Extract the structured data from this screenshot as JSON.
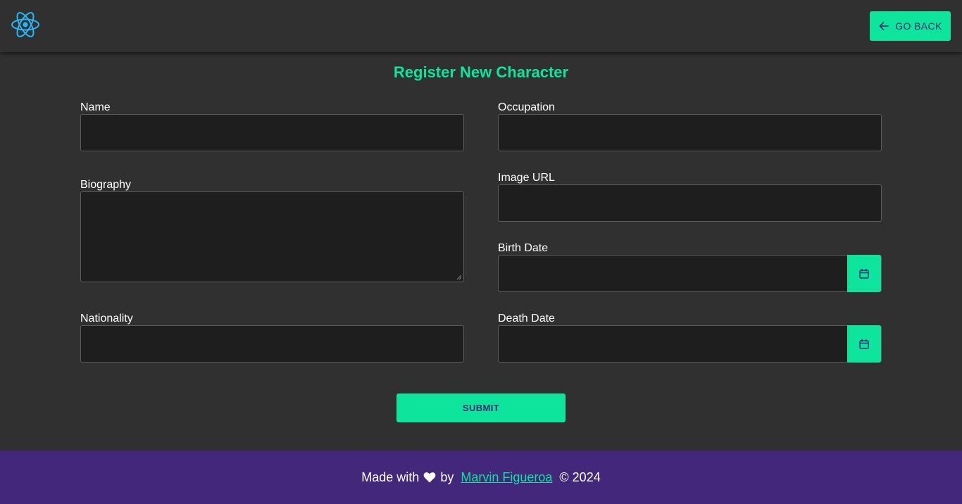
{
  "header": {
    "logo_icon": "react-atom-icon",
    "go_back_label": "GO BACK",
    "go_back_icon": "arrow-left-icon"
  },
  "form": {
    "title": "Register New Character",
    "fields": {
      "name": {
        "label": "Name",
        "value": ""
      },
      "occupation": {
        "label": "Occupation",
        "value": ""
      },
      "biography": {
        "label": "Biography",
        "value": ""
      },
      "image_url": {
        "label": "Image URL",
        "value": ""
      },
      "birth_date": {
        "label": "Birth Date",
        "value": "",
        "icon": "calendar-icon"
      },
      "nationality": {
        "label": "Nationality",
        "value": ""
      },
      "death_date": {
        "label": "Death Date",
        "value": "",
        "icon": "calendar-icon"
      }
    },
    "submit_label": "SUBMIT"
  },
  "footer": {
    "made_with": "Made with",
    "heart_icon": "heart-icon",
    "by": "by",
    "author": "Marvin Figueroa",
    "copyright": "© 2024"
  },
  "colors": {
    "accent": "#0de59c",
    "background": "#303030",
    "input_bg": "#1e1e1e",
    "footer_bg": "#42277a",
    "button_text": "#3b2a73",
    "logo": "#29b6f6"
  }
}
